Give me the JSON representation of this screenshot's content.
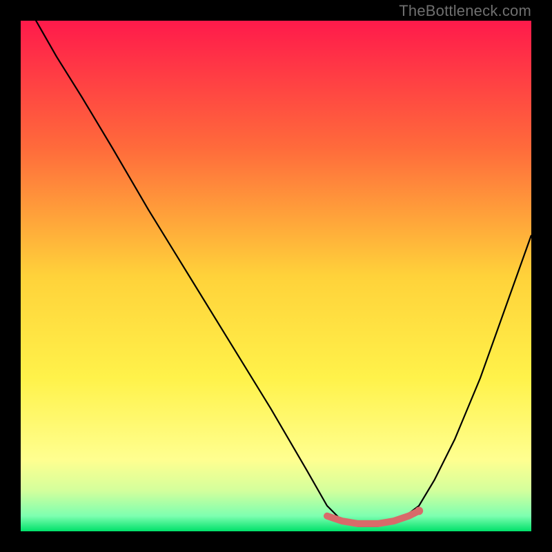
{
  "watermark": "TheBottleneck.com",
  "chart_data": {
    "type": "line",
    "title": "",
    "xlabel": "",
    "ylabel": "",
    "xlim": [
      0,
      100
    ],
    "ylim": [
      0,
      100
    ],
    "gradient_stops": [
      {
        "offset": 0,
        "color": "#ff1a4b"
      },
      {
        "offset": 25,
        "color": "#ff6b3b"
      },
      {
        "offset": 50,
        "color": "#ffd23a"
      },
      {
        "offset": 70,
        "color": "#fff24a"
      },
      {
        "offset": 86,
        "color": "#ffff90"
      },
      {
        "offset": 92,
        "color": "#d4ff9c"
      },
      {
        "offset": 97,
        "color": "#7dffb0"
      },
      {
        "offset": 100,
        "color": "#00e16a"
      }
    ],
    "series": [
      {
        "name": "curve",
        "color": "#000000",
        "x": [
          0,
          3,
          7,
          12,
          18,
          25,
          33,
          41,
          49,
          56,
          60,
          63,
          66,
          70,
          74,
          78,
          81,
          85,
          90,
          95,
          100
        ],
        "y": [
          105,
          100,
          93,
          85,
          75,
          63,
          50,
          37,
          24,
          12,
          5,
          2,
          1,
          1,
          2,
          5,
          10,
          18,
          30,
          44,
          58
        ]
      }
    ],
    "highlight": {
      "name": "optimal-zone",
      "color": "#d86a6a",
      "x": [
        60,
        63,
        66,
        70,
        73,
        76,
        78
      ],
      "y": [
        3,
        2,
        1.5,
        1.5,
        2,
        3,
        4
      ],
      "end_dot": {
        "x": 78,
        "y": 4,
        "r": 6
      }
    }
  }
}
